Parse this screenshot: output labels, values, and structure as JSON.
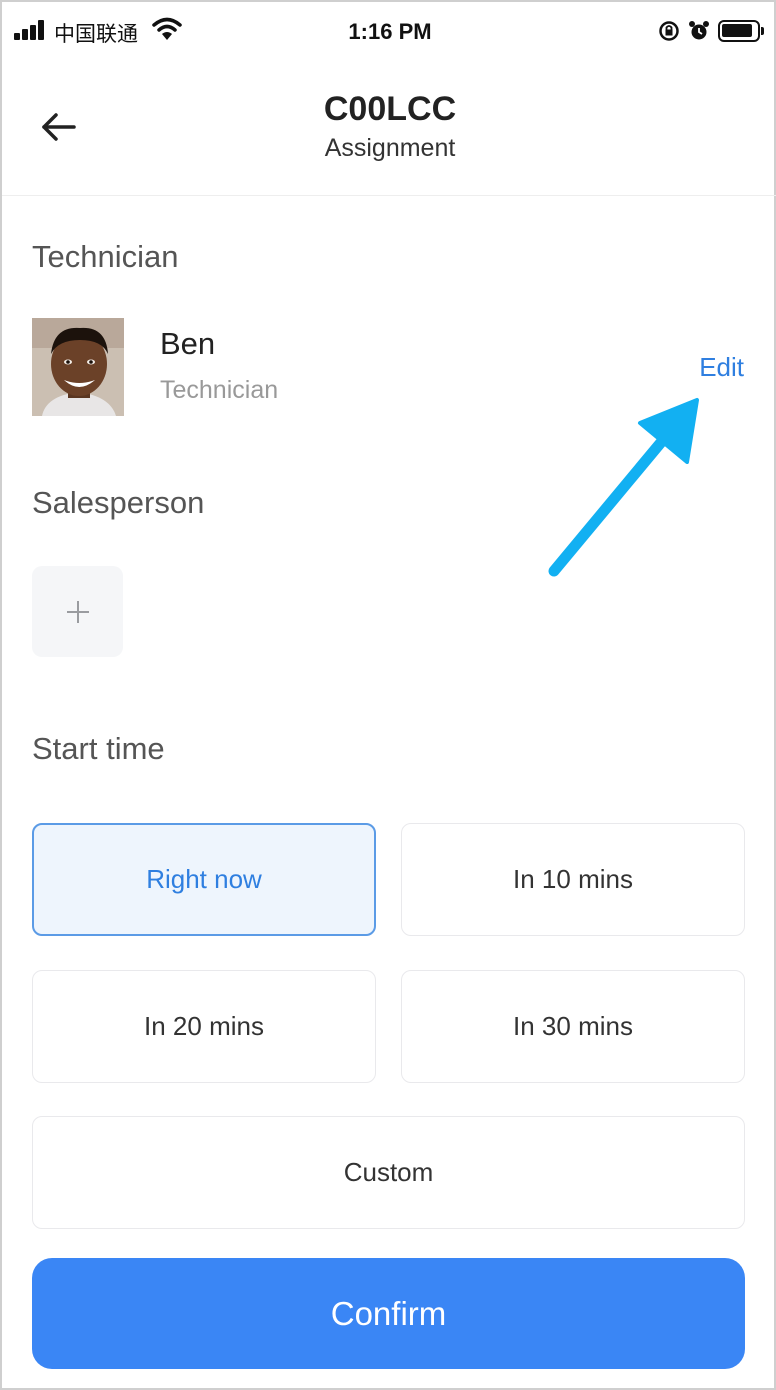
{
  "status_bar": {
    "carrier": "中国联通",
    "time": "1:16 PM"
  },
  "nav": {
    "title": "C00LCC",
    "subtitle": "Assignment"
  },
  "technician": {
    "section_label": "Technician",
    "name": "Ben",
    "role": "Technician",
    "edit_label": "Edit"
  },
  "salesperson": {
    "section_label": "Salesperson"
  },
  "start_time": {
    "section_label": "Start time",
    "options": [
      {
        "label": "Right now",
        "selected": true
      },
      {
        "label": "In 10 mins",
        "selected": false
      },
      {
        "label": "In 20 mins",
        "selected": false
      },
      {
        "label": "In 30 mins",
        "selected": false
      },
      {
        "label": "Custom",
        "selected": false
      }
    ]
  },
  "confirm_label": "Confirm",
  "colors": {
    "accent": "#3a86f5",
    "link": "#2f7fe0",
    "selected_bg": "#eef5fd",
    "annotation_arrow": "#12b0f2"
  },
  "icons": [
    "signal-icon",
    "wifi-icon",
    "orientation-lock-icon",
    "alarm-icon",
    "battery-icon",
    "back-arrow-icon",
    "plus-icon"
  ]
}
